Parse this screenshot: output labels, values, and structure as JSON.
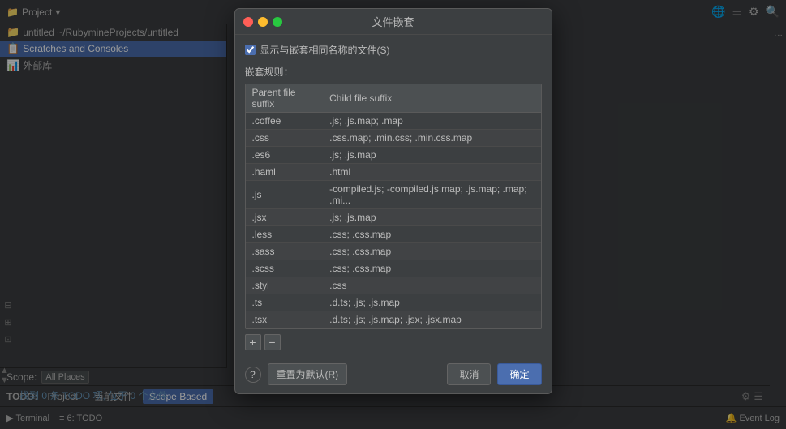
{
  "app": {
    "title": "文件嵌套",
    "project_label": "Project",
    "project_dropdown": "▾"
  },
  "sidebar": {
    "items": [
      {
        "label": "untitled  ~/RubymineProjects/untitled",
        "icon": "📁",
        "active": false
      },
      {
        "label": "Scratches and Consoles",
        "icon": "📋",
        "active": true
      },
      {
        "label": "外部库",
        "icon": "📊",
        "active": false
      }
    ]
  },
  "todo": {
    "label": "TODO:",
    "tabs": [
      {
        "label": "Project",
        "active": false
      },
      {
        "label": "当前文件",
        "active": false
      },
      {
        "label": "Scope Based",
        "active": true
      }
    ],
    "scope_label": "Scope:",
    "scope_value": "All Places",
    "result_text": "找到 0 条 TODO 项, 位于 0 个文件"
  },
  "dialog": {
    "title": "文件嵌套",
    "traffic": {
      "red": "close",
      "yellow": "minimize",
      "green": "maximize"
    },
    "checkbox_label": "显示与嵌套相同名称的文件(S)",
    "checkbox_checked": true,
    "nesting_rules_label": "嵌套规则：",
    "table": {
      "headers": [
        "Parent file suffix",
        "Child file suffix"
      ],
      "rows": [
        {
          "parent": ".coffee",
          "child": ".js; .js.map; .map"
        },
        {
          "parent": ".css",
          "child": ".css.map; .min.css; .min.css.map"
        },
        {
          "parent": ".es6",
          "child": ".js; .js.map"
        },
        {
          "parent": ".haml",
          "child": ".html"
        },
        {
          "parent": ".js",
          "child": "-compiled.js; -compiled.js.map; .js.map; .map; .mi..."
        },
        {
          "parent": ".jsx",
          "child": ".js; .js.map"
        },
        {
          "parent": ".less",
          "child": ".css; .css.map"
        },
        {
          "parent": ".sass",
          "child": ".css; .css.map"
        },
        {
          "parent": ".scss",
          "child": ".css; .css.map"
        },
        {
          "parent": ".styl",
          "child": ".css"
        },
        {
          "parent": ".ts",
          "child": ".d.ts; .js; .js.map"
        },
        {
          "parent": ".tsx",
          "child": ".d.ts; .js; .js.map; .jsx; .jsx.map"
        }
      ]
    },
    "add_icon": "+",
    "remove_icon": "−",
    "help_label": "?",
    "reset_label": "重置为默认(R)",
    "cancel_label": "取消",
    "ok_label": "确定"
  },
  "status_bar": {
    "terminal_label": "Terminal",
    "todo_label": "≡ 6: TODO",
    "event_log_label": "Event Log"
  }
}
